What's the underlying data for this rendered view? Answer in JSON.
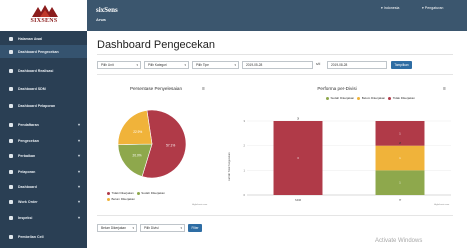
{
  "logo": {
    "text": "SIXSENS"
  },
  "sidebar": {
    "items": [
      {
        "label": "Halaman Awal",
        "caret": ""
      },
      {
        "label": "Dashboard Pengecekan",
        "caret": ""
      },
      {
        "label": "Dashboard Realisasi",
        "caret": ""
      },
      {
        "label": "Dashboard SDM",
        "caret": ""
      },
      {
        "label": "Dashboard Pelaporan",
        "caret": ""
      },
      {
        "label": "Pendaftaran",
        "caret": "▾"
      },
      {
        "label": "Pengecekan",
        "caret": "▾"
      },
      {
        "label": "Perbaikan",
        "caret": "▾"
      },
      {
        "label": "Pelaporan",
        "caret": "▾"
      },
      {
        "label": "Dashboard",
        "caret": "▾"
      },
      {
        "label": "Work Order",
        "caret": "▾"
      },
      {
        "label": "Inspeksi",
        "caret": "▾"
      },
      {
        "label": "Pembelian Cell",
        "caret": ""
      }
    ]
  },
  "topbar": {
    "brand": "sixSens",
    "user": "Arwa",
    "language": "▾ Indonesia",
    "settings": "▾ Pengaturan"
  },
  "page": {
    "title": "Dashboard Pengecekan"
  },
  "filters": {
    "unit": "Pilih Unit",
    "kategori": "Pilih Kategori",
    "tipe": "Pilih Tipe",
    "date_from": "2019-05-28",
    "sep": "s/d",
    "date_to": "2019-08-28",
    "apply": "Tampilkan"
  },
  "chart_data": [
    {
      "type": "pie",
      "title": "Persentase Penyelesaian",
      "labels": [
        "Tidak Dikerjakan",
        "Sudah Dikerjakan",
        "Belum Dikerjakan"
      ],
      "values": [
        57.1,
        20.0,
        22.9
      ],
      "data_labels": [
        "57.1%",
        "20.0%",
        "22.9%"
      ],
      "colors": [
        "#b03a48",
        "#8ea84c",
        "#f0b33a"
      ],
      "legend": "bottom",
      "credit": "Highcharts.com"
    },
    {
      "type": "bar",
      "title": "Performa per-Divisi",
      "categories": [
        "SDM",
        "IT"
      ],
      "series": [
        {
          "name": "Sudah Dikerjakan",
          "values": [
            0,
            1
          ],
          "color": "#8ea84c"
        },
        {
          "name": "Belum Dikerjakan",
          "values": [
            0,
            1
          ],
          "color": "#f0b33a"
        },
        {
          "name": "Tidak Dikerjakan",
          "values": [
            3,
            1
          ],
          "color": "#b03a48"
        }
      ],
      "stack_totals": [
        3,
        2
      ],
      "ylabel": "Jumlah Total Pengecekan",
      "ylim": [
        0,
        3
      ],
      "legend": "top",
      "credit": "Highcharts.com"
    }
  ],
  "bottom_filters": {
    "status": "Belum Dikerjakan",
    "divisi": "Pilih Divisi",
    "button": "Filter"
  },
  "watermark": "Activate Windows"
}
